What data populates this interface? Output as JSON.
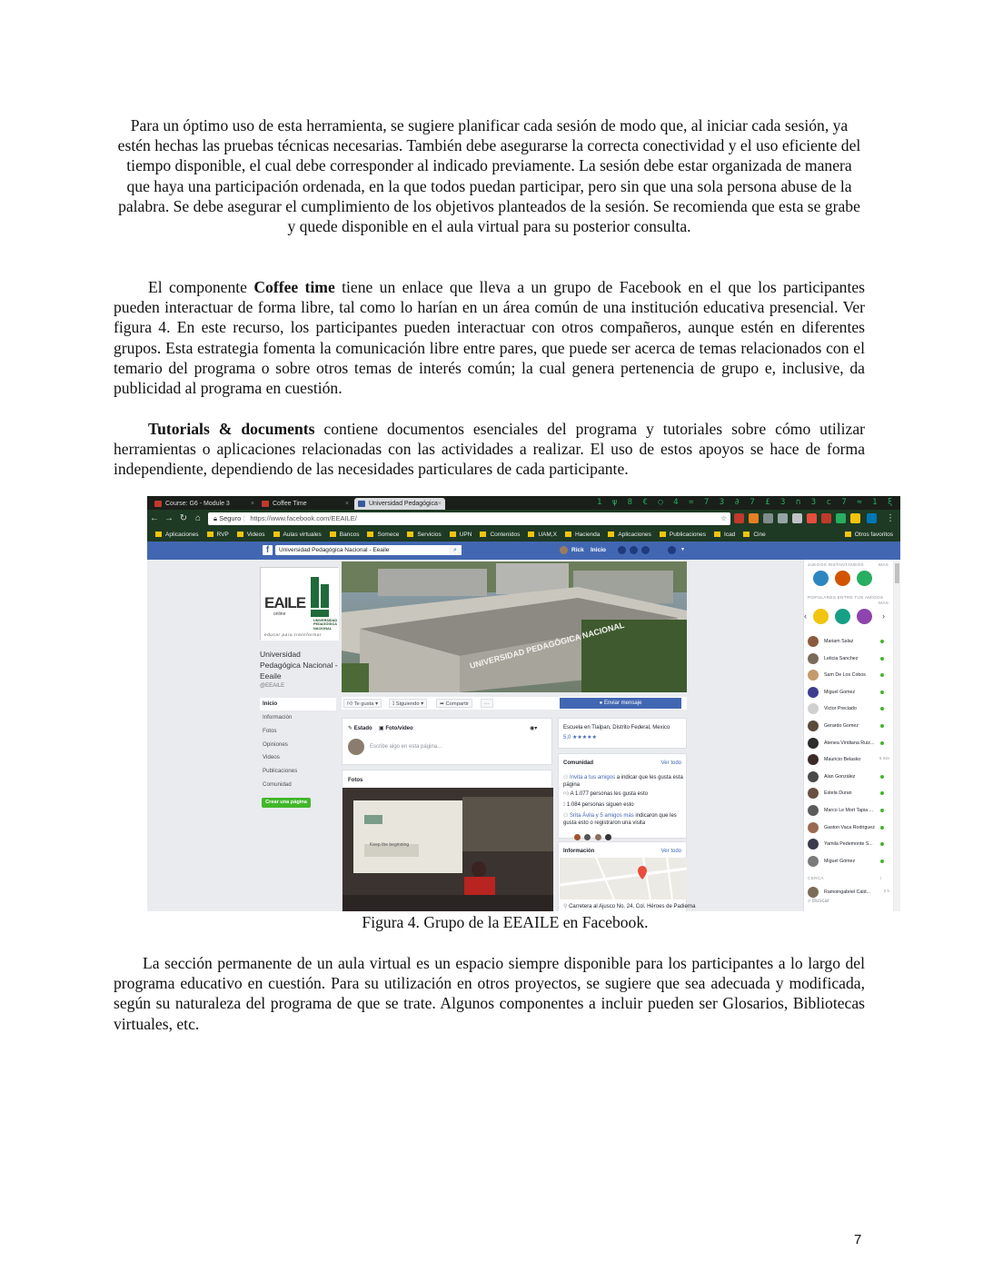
{
  "paragraphs": {
    "p1": "Para un óptimo uso de esta herramienta, se sugiere planificar cada sesión de modo que, al iniciar cada sesión, ya estén hechas las pruebas técnicas necesarias. También debe asegurarse la correcta conectividad y el uso eficiente del tiempo disponible, el cual debe corresponder al indicado previamente. La sesión debe estar organizada de manera que haya una participación ordenada, en la que todos puedan participar, pero sin que una sola persona abuse de la palabra. Se debe asegurar el cumplimiento de los objetivos planteados de la sesión. Se recomienda que esta se grabe y quede disponible en el aula virtual para su posterior consulta.",
    "p2_before": "El componente ",
    "p2_bold": "Coffee time",
    "p2_after": " tiene un enlace que lleva a un grupo de Facebook en el que los participantes pueden interactuar de forma libre, tal como lo harían en un área común de una institución educativa presencial. Ver figura 4. En este recurso, los participantes pueden interactuar con otros compañeros, aunque estén en diferentes grupos. Esta estrategia fomenta la comunicación libre entre pares, que puede ser acerca de temas relacionados con el temario del programa o sobre otros temas de interés común; la cual genera pertenencia de grupo e, inclusive, da publicidad al programa en cuestión.",
    "p3_bold": "Tutorials & documents",
    "p3_after": " contiene documentos esenciales del programa y tutoriales sobre cómo utilizar herramientas o aplicaciones relacionadas con las actividades a realizar. El uso de estos apoyos se hace de forma independiente, dependiendo de las necesidades particulares de cada participante.",
    "p4": "La sección permanente de un aula virtual es un espacio siempre disponible para los participantes a lo largo del programa educativo en cuestión. Para su utilización en otros proyectos, se sugiere que sea adecuada y modificada, según su naturaleza del programa de que se trate. Algunos componentes a incluir pueden ser Glosarios, Bibliotecas virtuales, etc."
  },
  "caption": "Figura 4. Grupo de la EEAILE en Facebook.",
  "page_number": "7",
  "screenshot": {
    "tabs": [
      "Course: G6 - Module 3",
      "Coffee Time",
      "Universidad Pedagógica"
    ],
    "address": {
      "secure": "Seguro",
      "url": "https://www.facebook.com/EEAILE/"
    },
    "bookmarks": [
      "Aplicaciones",
      "RVP",
      "Videos",
      "Aulas virtuales",
      "Bancos",
      "Somece",
      "Servicios",
      "UPN",
      "Contenidos",
      "UAM,X",
      "Hacienda",
      "Aplicaciones",
      "Publicaciones",
      "Icad",
      "Cine"
    ],
    "bookmarks_other": "Otros favoritos",
    "fb_search": "Universidad Pedagógica Nacional - Eeaile",
    "fb_user": "Rick",
    "fb_home": "Inicio",
    "page_name": "Universidad Pedagógica Nacional - Eeaile",
    "page_handle": "@EEAILE",
    "left_nav": [
      "Inicio",
      "Información",
      "Fotos",
      "Opiniones",
      "Videos",
      "Publicaciones",
      "Comunidad"
    ],
    "create_page": "Crear una página",
    "logo_text": "EEAILE",
    "logo_online": "online",
    "logo_upn": "UNIVERSIDAD PEDAGÓGICA NACIONAL",
    "logo_slogan": "educar para transformar",
    "cover_text": "UNIVERSIDAD PEDAGÓGICA NACIONAL",
    "actions": {
      "like": "Te gusta",
      "follow": "Siguiendo",
      "share": "Compartir",
      "more": "···",
      "message": "Enviar mensaje"
    },
    "composer": {
      "status": "Estado",
      "photo": "Foto/video",
      "placeholder": "Escribe algo en esta página..."
    },
    "photos_title": "Fotos",
    "slide_title": "Keep the beginning",
    "about": {
      "location": "Escuela en Tlalpan, Distrito Federal, Mexico",
      "rating": "5,0"
    },
    "community": {
      "title": "Comunidad",
      "see_all": "Ver todo",
      "invite": "Invita a tus amigos",
      "invite_rest": " a indicar que les gusta esta página",
      "likes": "A 1.077 personas les gusta esto",
      "follows": "1.084 personas siguen esto",
      "friends": "Srita Ávila y 5 amigos más",
      "friends_rest": " indicaron que les gusta esto o registraron una visita"
    },
    "info": {
      "title": "Información",
      "see_all": "Ver todo",
      "address": "Carretera al Ajusco No. 24, Col. Héroes de Padierna"
    },
    "sidebar": {
      "games_header": "JUEGOS INSTANTÁNEOS",
      "popular_header": "POPULARES ENTRE TUS AMIGOS",
      "more": "MÁS",
      "contacts": [
        "Mariam Salaz",
        "Leticia Sanchez",
        "Sam De Los Cobos",
        "Miguel Gomez",
        "Victor Preciado",
        "Gerardo Gomez",
        "Atenea Viridiana Ruiz...",
        "Mauricio Belasko",
        "Alan González",
        "Estela Duran",
        "Marco Le Mort Tapia ...",
        "Gaston Vaca Rodriguez",
        "Yamila Pedemonte S...",
        "Miguel Gómez"
      ],
      "mauricio_time": "5 min",
      "nearby_header": "CERCA",
      "nearby": "Ramoingabriel Cald...",
      "nearby_time": "2 h",
      "search": "Buscar"
    }
  }
}
